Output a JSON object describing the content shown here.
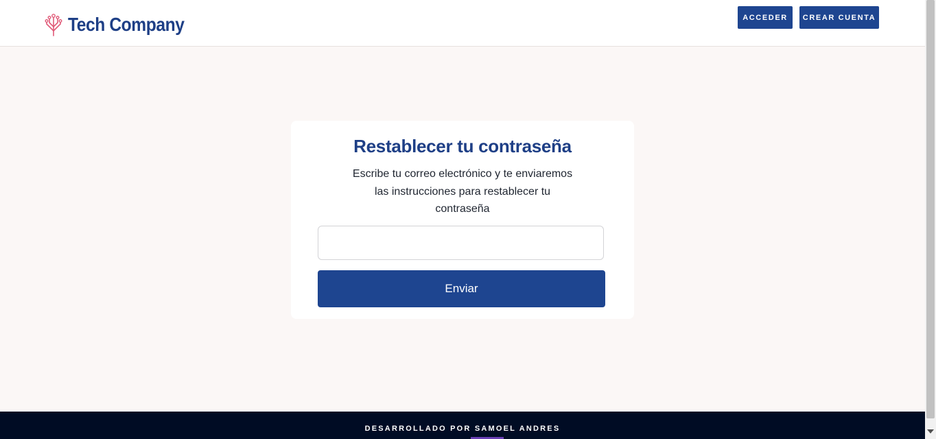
{
  "header": {
    "logo_text": "Tech Company",
    "login_label": "ACCEDER",
    "register_label": "CREAR CUENTA"
  },
  "reset_card": {
    "title": "Restablecer tu contraseña",
    "description": "Escribe tu correo electrónico y te enviaremos las instrucciones para restablecer tu contraseña",
    "email_value": "",
    "submit_label": "Enviar"
  },
  "footer": {
    "credit": "DESARROLLADO POR SAMOEL ANDRES"
  },
  "colors": {
    "brand": "#1e4590",
    "logo_icon": "#e05a78",
    "footer_bg": "#000c24",
    "page_bg": "#fbf7f6"
  },
  "icons": {
    "logo": "circuit-tree-icon"
  }
}
